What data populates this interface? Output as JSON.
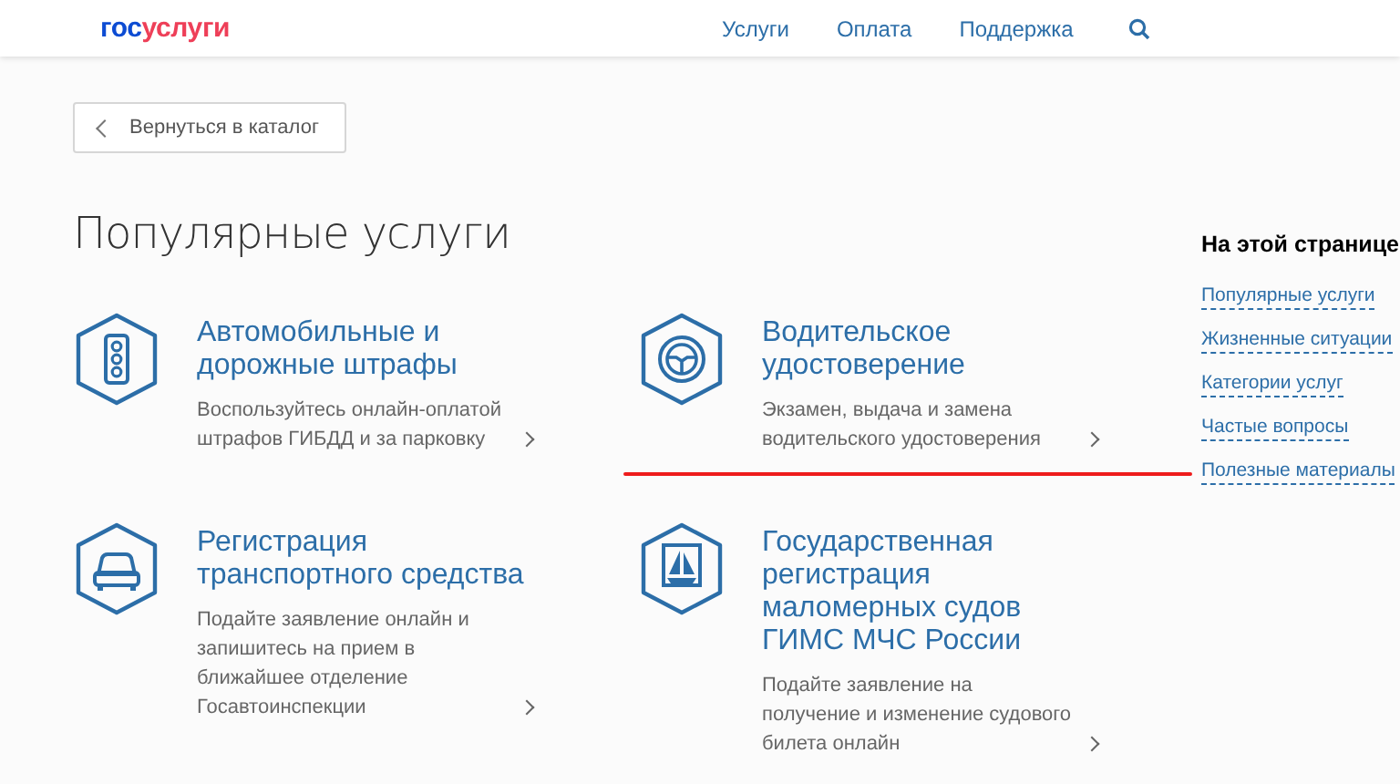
{
  "header": {
    "logo": {
      "part_1": "гос",
      "part_2": "услуги"
    },
    "nav": [
      {
        "label": "Услуги"
      },
      {
        "label": "Оплата"
      },
      {
        "label": "Поддержка"
      }
    ]
  },
  "back_button": {
    "label": "Вернуться в каталог"
  },
  "section_title": "Популярные услуги",
  "services": [
    {
      "kind": "traffic-light",
      "title": "Автомобильные и дорожные штрафы",
      "description": "Воспользуйтесь онлайн-оплатой штрафов ГИБДД и за парковку",
      "underlined": false
    },
    {
      "kind": "steering-wheel",
      "title": "Водительское удостоверение",
      "description": "Экзамен, выдача и замена водительского удостоверения",
      "underlined": true
    },
    {
      "kind": "car",
      "title": "Регистрация транспортного средства",
      "description": "Подайте заявление онлайн и запишитесь на прием в ближайшее отделение Госавтоинспекции",
      "underlined": false
    },
    {
      "kind": "boat",
      "title": "Государственная регистрация маломерных судов ГИМС МЧС России",
      "description": "Подайте заявление на получение и изменение судового билета онлайн",
      "underlined": false
    }
  ],
  "sidebar": {
    "title": "На этой странице",
    "links": [
      {
        "label": "Популярные услуги"
      },
      {
        "label": "Жизненные ситуации"
      },
      {
        "label": "Категории услуг"
      },
      {
        "label": "Частые вопросы"
      },
      {
        "label": "Полезные материалы"
      }
    ]
  }
}
